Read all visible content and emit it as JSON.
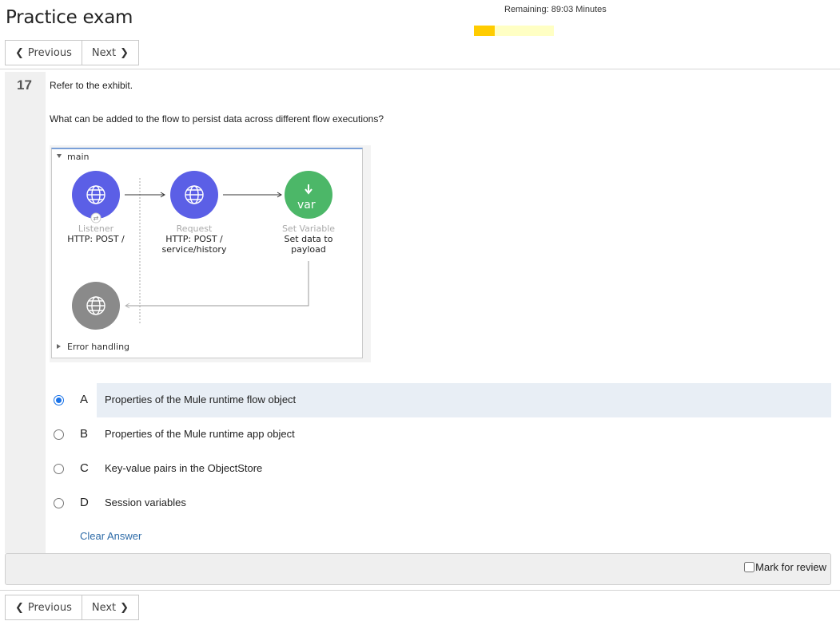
{
  "header": {
    "title": "Practice exam",
    "timer_text": "Remaining: 89:03 Minutes",
    "progress_fraction": 0.26
  },
  "nav": {
    "previous_label": "Previous",
    "next_label": "Next"
  },
  "question": {
    "number": "17",
    "intro": "Refer to the exhibit.",
    "prompt": "What can be added to the flow to persist data across different flow executions?"
  },
  "exhibit": {
    "flow_name": "main",
    "error_handling_label": "Error handling",
    "components": [
      {
        "type": "Listener",
        "name": "HTTP: POST /",
        "icon": "globe-icon"
      },
      {
        "type": "Request",
        "name": "HTTP: POST / service/history",
        "name_line1": "HTTP: POST /",
        "name_line2": "service/history",
        "icon": "globe-icon"
      },
      {
        "type": "Set Variable",
        "name": "Set data to payload",
        "name_line1": "Set data to",
        "name_line2": "payload",
        "icon": "var-icon",
        "icon_text": "var"
      }
    ],
    "colors": {
      "listener": "#5b5fe6",
      "request": "#5b5fe6",
      "setvar": "#4cb768",
      "response": "#8a8a8a"
    }
  },
  "options": [
    {
      "letter": "A",
      "text": "Properties of the Mule runtime flow object",
      "selected": true
    },
    {
      "letter": "B",
      "text": "Properties of the Mule runtime app object",
      "selected": false
    },
    {
      "letter": "C",
      "text": "Key-value pairs in the ObjectStore",
      "selected": false
    },
    {
      "letter": "D",
      "text": "Session variables",
      "selected": false
    }
  ],
  "clear_answer_label": "Clear Answer",
  "mark_for_review_label": "Mark for review"
}
